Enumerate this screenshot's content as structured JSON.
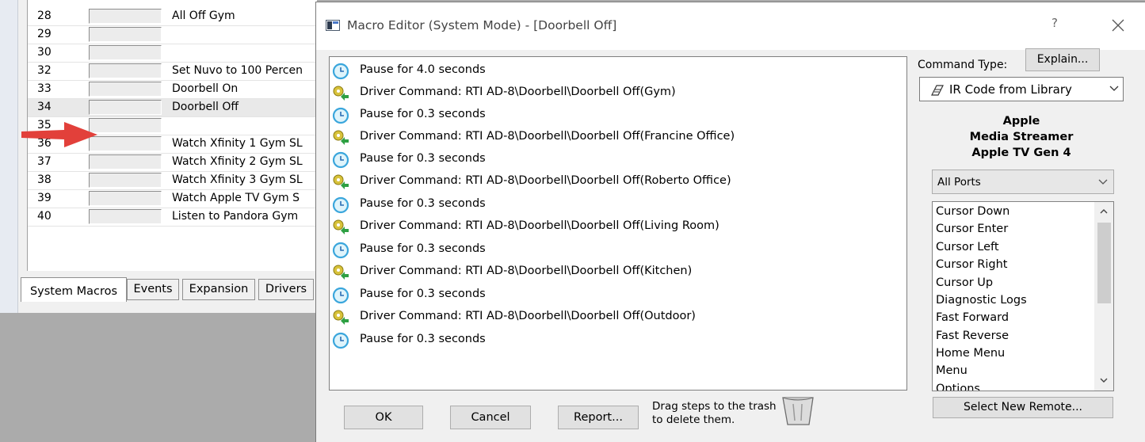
{
  "background_window": {
    "rows": [
      {
        "num": "28",
        "name": "All Off Gym"
      },
      {
        "num": "29",
        "name": ""
      },
      {
        "num": "30",
        "name": ""
      },
      {
        "num": "32",
        "name": "Set Nuvo to 100 Percen"
      },
      {
        "num": "33",
        "name": "Doorbell On"
      },
      {
        "num": "34",
        "name": "Doorbell Off"
      },
      {
        "num": "35",
        "name": ""
      },
      {
        "num": "36",
        "name": "Watch Xfinity 1 Gym SL"
      },
      {
        "num": "37",
        "name": "Watch Xfinity 2 Gym SL"
      },
      {
        "num": "38",
        "name": "Watch Xfinity 3 Gym SL"
      },
      {
        "num": "39",
        "name": "Watch Apple TV Gym S"
      },
      {
        "num": "40",
        "name": "Listen to Pandora Gym"
      }
    ],
    "tabs": [
      "System Macros",
      "Events",
      "Expansion",
      "Drivers"
    ]
  },
  "dialog": {
    "title": "Macro Editor (System Mode) - [Doorbell Off]",
    "help_label": "?",
    "steps": [
      {
        "type": "pause",
        "text": "Pause for 4.0 seconds"
      },
      {
        "type": "driver",
        "text": "Driver Command: RTI AD-8\\Doorbell\\Doorbell Off(Gym)"
      },
      {
        "type": "pause",
        "text": "Pause for 0.3 seconds"
      },
      {
        "type": "driver",
        "text": "Driver Command: RTI AD-8\\Doorbell\\Doorbell Off(Francine Office)"
      },
      {
        "type": "pause",
        "text": "Pause for 0.3 seconds"
      },
      {
        "type": "driver",
        "text": "Driver Command: RTI AD-8\\Doorbell\\Doorbell Off(Roberto Office)"
      },
      {
        "type": "pause",
        "text": "Pause for 0.3 seconds"
      },
      {
        "type": "driver",
        "text": "Driver Command: RTI AD-8\\Doorbell\\Doorbell Off(Living Room)"
      },
      {
        "type": "pause",
        "text": "Pause for 0.3 seconds"
      },
      {
        "type": "driver",
        "text": "Driver Command: RTI AD-8\\Doorbell\\Doorbell Off(Kitchen)"
      },
      {
        "type": "pause",
        "text": "Pause for 0.3 seconds"
      },
      {
        "type": "driver",
        "text": "Driver Command: RTI AD-8\\Doorbell\\Doorbell Off(Outdoor)"
      },
      {
        "type": "pause",
        "text": "Pause for 0.3 seconds"
      }
    ],
    "buttons": {
      "ok": "OK",
      "cancel": "Cancel",
      "report": "Report..."
    },
    "trash_hint": "Drag steps to the trash to delete them.",
    "command_type_label": "Command Type:",
    "explain_label": "Explain...",
    "command_type_value": "IR Code from Library",
    "device": {
      "line1": "Apple",
      "line2": "Media Streamer",
      "line3": "Apple TV Gen 4"
    },
    "ports_value": "All Ports",
    "commands": [
      "Cursor Down",
      "Cursor Enter",
      "Cursor Left",
      "Cursor Right",
      "Cursor Up",
      "Diagnostic Logs",
      "Fast Forward",
      "Fast Reverse",
      "Home Menu",
      "Menu",
      "Options"
    ],
    "select_remote_label": "Select New Remote..."
  }
}
